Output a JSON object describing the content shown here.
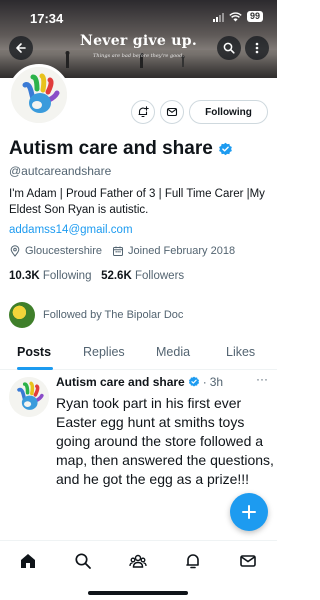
{
  "status_bar": {
    "time": "17:34",
    "battery": "99"
  },
  "banner": {
    "title": "Never give up.",
    "subtitle": "Things are bad before they're good."
  },
  "profile": {
    "name": "Autism care and share",
    "handle": "@autcareandshare",
    "bio": "I'm Adam | Proud Father of 3 | Full Time Carer |My Eldest Son Ryan is autistic.",
    "link": "addamss14@gmail.com",
    "location": "Gloucestershire",
    "joined": "Joined February 2018",
    "following_count": "10.3K",
    "following_label": "Following",
    "followers_count": "52.6K",
    "followers_label": "Followers",
    "followed_by": "Followed by The Bipolar Doc"
  },
  "actions": {
    "following_button": "Following"
  },
  "tabs": [
    {
      "label": "Posts"
    },
    {
      "label": "Replies"
    },
    {
      "label": "Media"
    },
    {
      "label": "Likes"
    }
  ],
  "post": {
    "name": "Autism care and share",
    "time": "3h",
    "separator": "·",
    "more": "···",
    "text": "Ryan took part in his first ever Easter egg hunt at smiths toys  going around the store followed a  map, then answered the questions,  and he got the egg as a prize!!!"
  },
  "colors": {
    "accent": "#1d9bf0",
    "text": "#0f1419",
    "muted": "#536471"
  },
  "icons": [
    "back-arrow-icon",
    "search-icon",
    "more-icon",
    "notification-plus-icon",
    "message-icon",
    "verified-icon",
    "location-icon",
    "calendar-icon",
    "compose-icon",
    "home-icon",
    "search-nav-icon",
    "communities-icon",
    "notifications-icon",
    "messages-icon"
  ]
}
